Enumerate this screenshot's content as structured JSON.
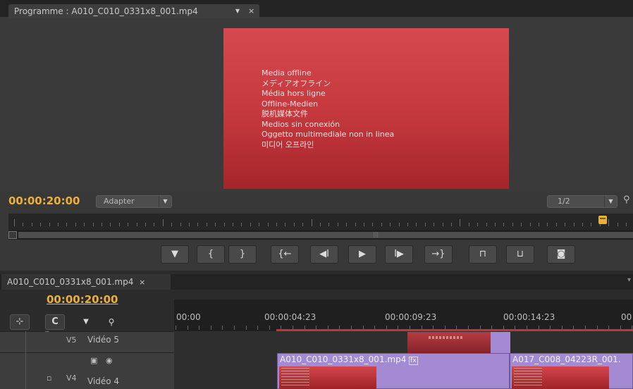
{
  "program_monitor": {
    "tab_title": "Programme : A010_C010_0331x8_001.mp4",
    "tab_menu_icon": "chevron-down-icon",
    "tab_close": "×",
    "offline_lines": [
      "Media offline",
      "メディアオフライン",
      "Média hors ligne",
      "Offline-Medien",
      "脱机媒体文件",
      "Medios sin conexión",
      "Oggetto multimediale non in linea",
      "미디어 오프라인"
    ],
    "timecode": "00:00:20:00",
    "fit_value": "Adapter",
    "resolution_value": "1/2",
    "settings_icon": "wrench-icon",
    "marker_color": "#e9b13a",
    "offline_color": "#c4383d"
  },
  "transport": [
    {
      "name": "add-marker-button",
      "icon": "marker-icon",
      "glyph": "▼"
    },
    {
      "name": "mark-in-button",
      "icon": "mark-in-icon",
      "glyph": "{"
    },
    {
      "name": "mark-out-button",
      "icon": "mark-out-icon",
      "glyph": "}"
    },
    {
      "name": "go-to-in-button",
      "icon": "go-to-in-icon",
      "glyph": "{←"
    },
    {
      "name": "step-back-button",
      "icon": "step-back-icon",
      "glyph": "◀I"
    },
    {
      "name": "play-button",
      "icon": "play-icon",
      "glyph": "▶"
    },
    {
      "name": "step-forward-button",
      "icon": "step-forward-icon",
      "glyph": "I▶"
    },
    {
      "name": "go-to-out-button",
      "icon": "go-to-out-icon",
      "glyph": "→}"
    },
    {
      "name": "lift-button",
      "icon": "lift-icon",
      "glyph": "⊓"
    },
    {
      "name": "extract-button",
      "icon": "extract-icon",
      "glyph": "⊔"
    },
    {
      "name": "export-frame-button",
      "icon": "camera-icon",
      "glyph": "◙"
    }
  ],
  "timeline": {
    "tab_title": "A010_C010_0331x8_001.mp4",
    "tab_close": "×",
    "timecode": "00:00:20:00",
    "ruler_labels": [
      "00:00",
      "00:00:04:23",
      "00:00:09:23",
      "00:00:14:23",
      "00"
    ],
    "tools": [
      {
        "name": "nest-sequence-tool",
        "icon": "nest-icon",
        "glyph": "⊹"
      },
      {
        "name": "snap-tool",
        "icon": "magnet-icon",
        "glyph": "C"
      },
      {
        "name": "add-marker-tool",
        "icon": "marker-icon",
        "glyph": "▼"
      },
      {
        "name": "timeline-settings-tool",
        "icon": "wrench-icon",
        "glyph": "🔧"
      }
    ],
    "tracks": [
      {
        "id": "V5",
        "name": "Vidéo 5"
      },
      {
        "id": "V4",
        "name": "Vidéo 4"
      }
    ],
    "clips": [
      {
        "name": "A010_C010_0331x8_001.mp4",
        "fx": "fx"
      },
      {
        "name": "A017_C008_04223R_001."
      }
    ],
    "clip_color": "#a48ad2",
    "work_area_color": "#c8333a"
  }
}
